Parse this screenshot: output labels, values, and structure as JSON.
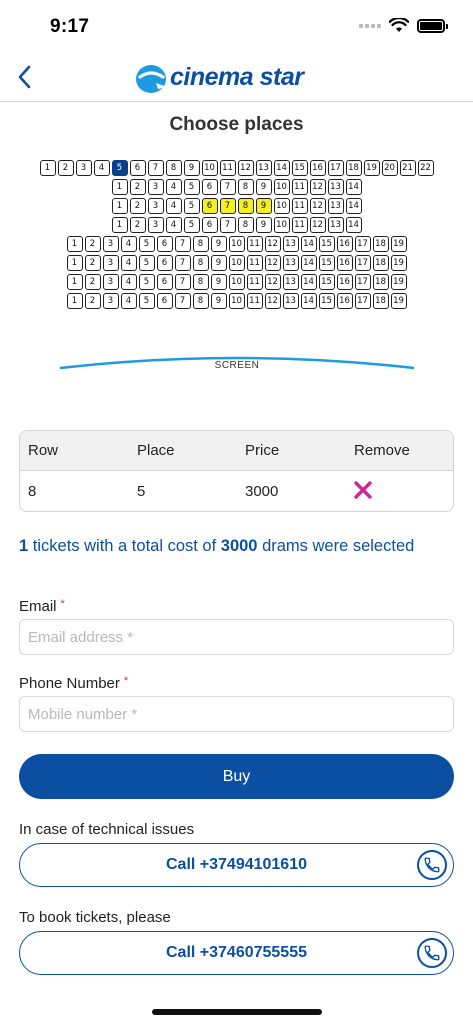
{
  "status": {
    "time": "9:17"
  },
  "header": {
    "logo_text": "cinema star",
    "title": "Choose places"
  },
  "seat_map": {
    "rows": [
      {
        "seats": 22,
        "selected": [
          5
        ],
        "reserved": []
      },
      {
        "seats": 14,
        "selected": [],
        "reserved": []
      },
      {
        "seats": 14,
        "selected": [],
        "reserved": [
          6,
          7,
          8,
          9
        ]
      },
      {
        "seats": 14,
        "selected": [],
        "reserved": []
      },
      {
        "seats": 19,
        "selected": [],
        "reserved": []
      },
      {
        "seats": 19,
        "selected": [],
        "reserved": []
      },
      {
        "seats": 19,
        "selected": [],
        "reserved": []
      },
      {
        "seats": 19,
        "selected": [],
        "reserved": []
      }
    ],
    "screen_label": "SCREEN",
    "colors": {
      "selected": "#0b3f8c",
      "reserved": "#f5ef1e"
    }
  },
  "table": {
    "headers": [
      "Row",
      "Place",
      "Price",
      "Remove"
    ],
    "rows": [
      {
        "row": "8",
        "place": "5",
        "price": "3000"
      }
    ]
  },
  "summary": {
    "count": "1",
    "text_a": " tickets with a total cost of ",
    "total": "3000",
    "text_b": " drams were selected"
  },
  "form": {
    "email_label": "Email",
    "email_placeholder": "Email address *",
    "email_value": "",
    "phone_label": "Phone Number",
    "phone_placeholder": "Mobile number *",
    "phone_value": "",
    "required_mark": "*"
  },
  "buy_label": "Buy",
  "support": {
    "tech_text": "In case of technical issues",
    "tech_call": "Call +37494101610",
    "book_text": "To book tickets, please",
    "book_call": "Call +37460755555"
  },
  "colors": {
    "brand": "#0b4fa3",
    "remove": "#c8289a"
  }
}
